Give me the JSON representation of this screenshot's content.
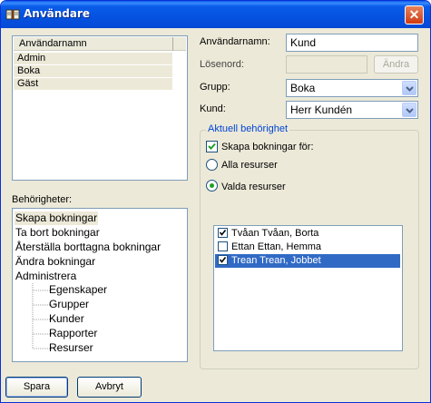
{
  "window": {
    "title": "Användare",
    "close_glyph": "✕"
  },
  "users": {
    "column_header": "Användarnamn",
    "items": [
      "Admin",
      "Boka",
      "Gäst"
    ]
  },
  "permissions": {
    "label": "Behörigheter:",
    "items": [
      "Skapa bokningar",
      "Ta bort bokningar",
      "Återställa borttagna bokningar",
      "Ändra bokningar",
      "Administrera",
      "Egenskaper",
      "Grupper",
      "Kunder",
      "Rapporter",
      "Resurser"
    ]
  },
  "form": {
    "username_label": "Användarnamn:",
    "username_value": "Kund",
    "password_label": "Lösenord:",
    "password_value": "",
    "change_button": "Ändra",
    "group_label": "Grupp:",
    "group_value": "Boka",
    "customer_label": "Kund:",
    "customer_value": "Herr Kundén"
  },
  "current_permission": {
    "title": "Aktuell behörighet",
    "create_bookings_label": "Skapa bokningar för:",
    "create_bookings_checked": true,
    "all_resources_label": "Alla resurser",
    "selected_resources_label": "Valda resurser",
    "selected_option": "Valda resurser"
  },
  "resources": [
    {
      "label": "Tvåan Tvåan, Borta",
      "checked": true,
      "selected": false
    },
    {
      "label": "Ettan Ettan, Hemma",
      "checked": false,
      "selected": false
    },
    {
      "label": "Trean Trean, Jobbet",
      "checked": true,
      "selected": true
    }
  ],
  "buttons": {
    "save": "Spara",
    "cancel": "Avbryt"
  },
  "colors": {
    "title_bar": "#0a5de8",
    "selection": "#316ac5",
    "group_title": "#0046d5",
    "check_green": "#21a121"
  }
}
